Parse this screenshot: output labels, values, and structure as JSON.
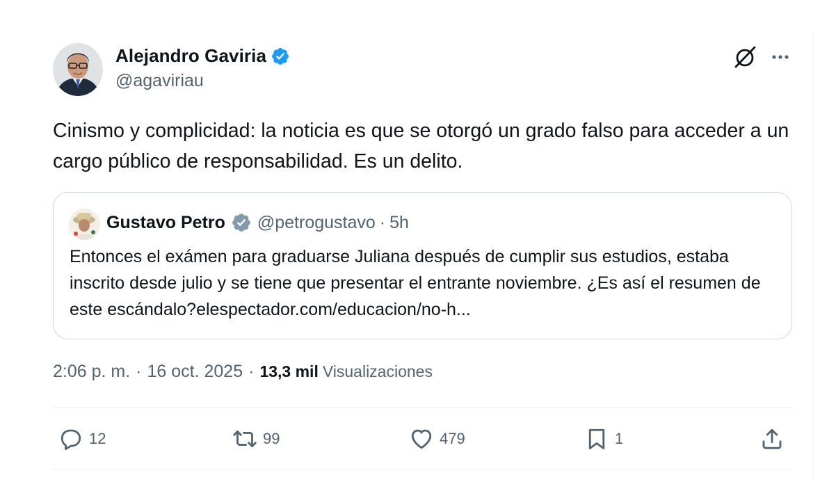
{
  "author": {
    "name": "Alejandro Gaviria",
    "handle": "@agaviriau"
  },
  "tweet": {
    "text": "Cinismo y complicidad: la noticia es que se otorgó un grado falso para acceder a un cargo público de responsabilidad. Es un delito."
  },
  "quoted": {
    "name": "Gustavo Petro",
    "handle": "@petrogustavo",
    "separator": "·",
    "time": "5h",
    "text": "Entonces el exámen para graduarse Juliana después de cumplir sus estudios, estaba inscrito desde julio y se tiene que presentar el entrante noviembre. ¿Es así el resumen de este escándalo?elespectador.com/educacion/no-h..."
  },
  "meta": {
    "time": "2:06 p. m.",
    "separator": "·",
    "date": "16 oct. 2025",
    "views_count": "13,3 mil",
    "views_label": "Visualizaciones"
  },
  "actions": {
    "reply_count": "12",
    "retweet_count": "99",
    "like_count": "479",
    "bookmark_count": "1"
  },
  "icons": {
    "verified": "verified-badge-icon",
    "grok": "grok-icon",
    "more": "more-icon",
    "reply": "reply-icon",
    "retweet": "retweet-icon",
    "like": "heart-icon",
    "bookmark": "bookmark-icon",
    "share": "share-icon"
  },
  "colors": {
    "verified_blue": "#1d9bf0",
    "verified_gray": "#829aab",
    "secondary_text": "#536471",
    "primary_text": "#0f1419",
    "border": "#cfd9de"
  }
}
